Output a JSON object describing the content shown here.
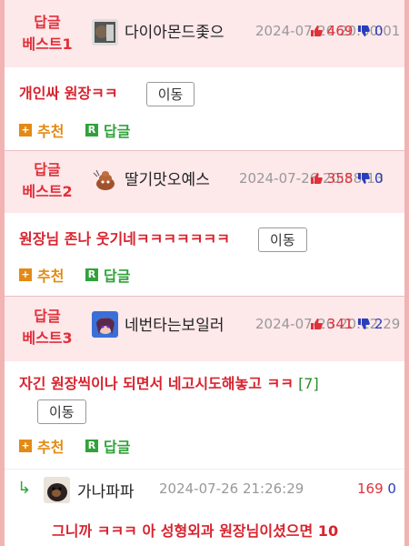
{
  "comments": [
    {
      "best_label": "답글\n베스트1",
      "nickname": "다이아몬드좇으",
      "date": "2024-07-26 20:00:01",
      "upvotes": "469",
      "downvotes": "0",
      "text": "개인싸 원장ㅋㅋ",
      "move_label": "이동",
      "reply_count": ""
    },
    {
      "best_label": "답글\n베스트2",
      "nickname": "딸기맛오예스",
      "date": "2024-07-26 20:58:13",
      "upvotes": "358",
      "downvotes": "0",
      "text": "원장님 존나 웃기네ㅋㅋㅋㅋㅋㅋㅋ",
      "move_label": "이동",
      "reply_count": ""
    },
    {
      "best_label": "답글\n베스트3",
      "nickname": "네번타는보일러",
      "date": "2024-07-26 20:12:29",
      "upvotes": "341",
      "downvotes": "2",
      "text": "자긴 원장씩이나 되면서 네고시도해놓고 ㅋㅋ",
      "move_label": "이동",
      "reply_count": "[7]"
    }
  ],
  "actions": {
    "recommend": "추천",
    "reply": "답글",
    "recommend_icon": "+",
    "reply_icon": "R"
  },
  "reply": {
    "arrow": "↳",
    "nickname": "가나파파",
    "date": "2024-07-26 21:26:29",
    "upvotes": "169",
    "downvotes": "0",
    "text": "그니까 ㅋㅋㅋ 아 성형외과 원장님이셨으면 10"
  },
  "colors": {
    "accent": "#e0303a",
    "background": "#f2b3b3",
    "best_bg": "#fde8ea"
  }
}
